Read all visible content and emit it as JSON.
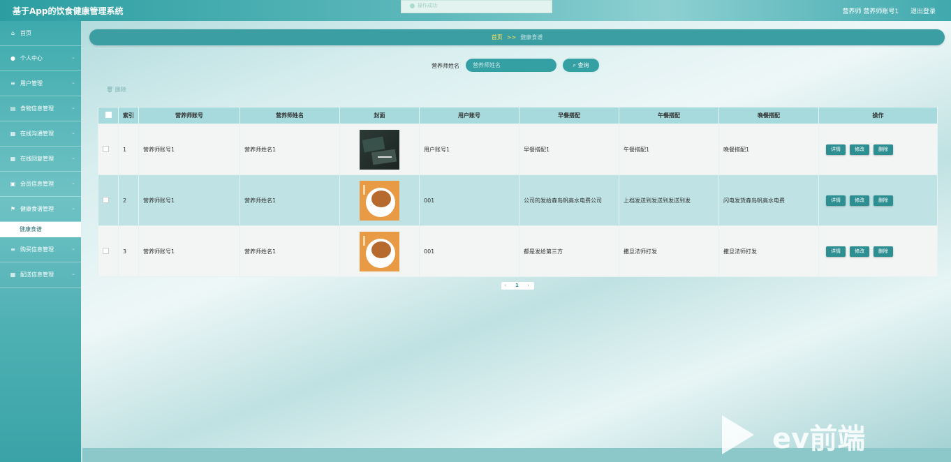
{
  "app": {
    "title": "基于App的饮食健康管理系统"
  },
  "topbar": {
    "user_label": "营养师 营养师账号1",
    "logout_label": "退出登录"
  },
  "toast": {
    "text": "操作成功"
  },
  "sidebar": {
    "items": [
      {
        "label": "首页",
        "icon": "home-icon",
        "glyph": "⌂",
        "arrow": ""
      },
      {
        "label": "个人中心",
        "icon": "user-icon",
        "glyph": "●",
        "arrow": "⌄"
      },
      {
        "label": "用户管理",
        "icon": "list-icon",
        "glyph": "≡",
        "arrow": "⌄"
      },
      {
        "label": "食物信息管理",
        "icon": "database-icon",
        "glyph": "▤",
        "arrow": "⌄"
      },
      {
        "label": "在线沟通管理",
        "icon": "grid-icon",
        "glyph": "▦",
        "arrow": "⌄"
      },
      {
        "label": "在线回复管理",
        "icon": "apps-icon",
        "glyph": "▦",
        "arrow": "⌄"
      },
      {
        "label": "会员信息管理",
        "icon": "card-icon",
        "glyph": "▣",
        "arrow": "⌄"
      },
      {
        "label": "健康食谱管理",
        "icon": "flag-icon",
        "glyph": "⚑",
        "arrow": "⌄"
      }
    ],
    "subitem": {
      "label": "健康食谱"
    },
    "items_after": [
      {
        "label": "购买信息管理",
        "icon": "list-icon",
        "glyph": "≡",
        "arrow": "⌄"
      },
      {
        "label": "配送信息管理",
        "icon": "apps-icon",
        "glyph": "▦",
        "arrow": "⌄"
      }
    ]
  },
  "breadcrumb": {
    "home": "首页",
    "sep": ">>",
    "current": "健康食谱"
  },
  "search": {
    "label": "营养师姓名",
    "placeholder": "营养师姓名",
    "button": "查询",
    "button_icon": "search-icon"
  },
  "actions": {
    "delete": "删除"
  },
  "table": {
    "headers": [
      "索引",
      "营养师账号",
      "营养师姓名",
      "封面",
      "用户账号",
      "早餐搭配",
      "午餐搭配",
      "晚餐搭配",
      "操作"
    ],
    "rows": [
      {
        "index": "1",
        "account": "营养师账号1",
        "name": "营养师姓名1",
        "cover": "dark",
        "user": "用户账号1",
        "breakfast": "早餐搭配1",
        "lunch": "午餐搭配1",
        "dinner": "晚餐搭配1"
      },
      {
        "index": "2",
        "account": "营养师账号1",
        "name": "营养师姓名1",
        "cover": "food",
        "user": "001",
        "breakfast": "公司的发给森岛帆高水电费公司",
        "lunch": "上档发送到发送到发送到发",
        "dinner": "闪电发货森岛帆高水电费"
      },
      {
        "index": "3",
        "account": "营养师账号1",
        "name": "营养师姓名1",
        "cover": "food",
        "user": "001",
        "breakfast": "都是发给第三方",
        "lunch": "撒旦法师打发",
        "dinner": "撒旦法师打发"
      }
    ],
    "buttons": {
      "detail": "详情",
      "edit": "修改",
      "delete": "删除"
    }
  },
  "pagination": {
    "prev": "‹",
    "page": "1",
    "next": "›"
  },
  "watermark": {
    "text": "ev前端"
  }
}
